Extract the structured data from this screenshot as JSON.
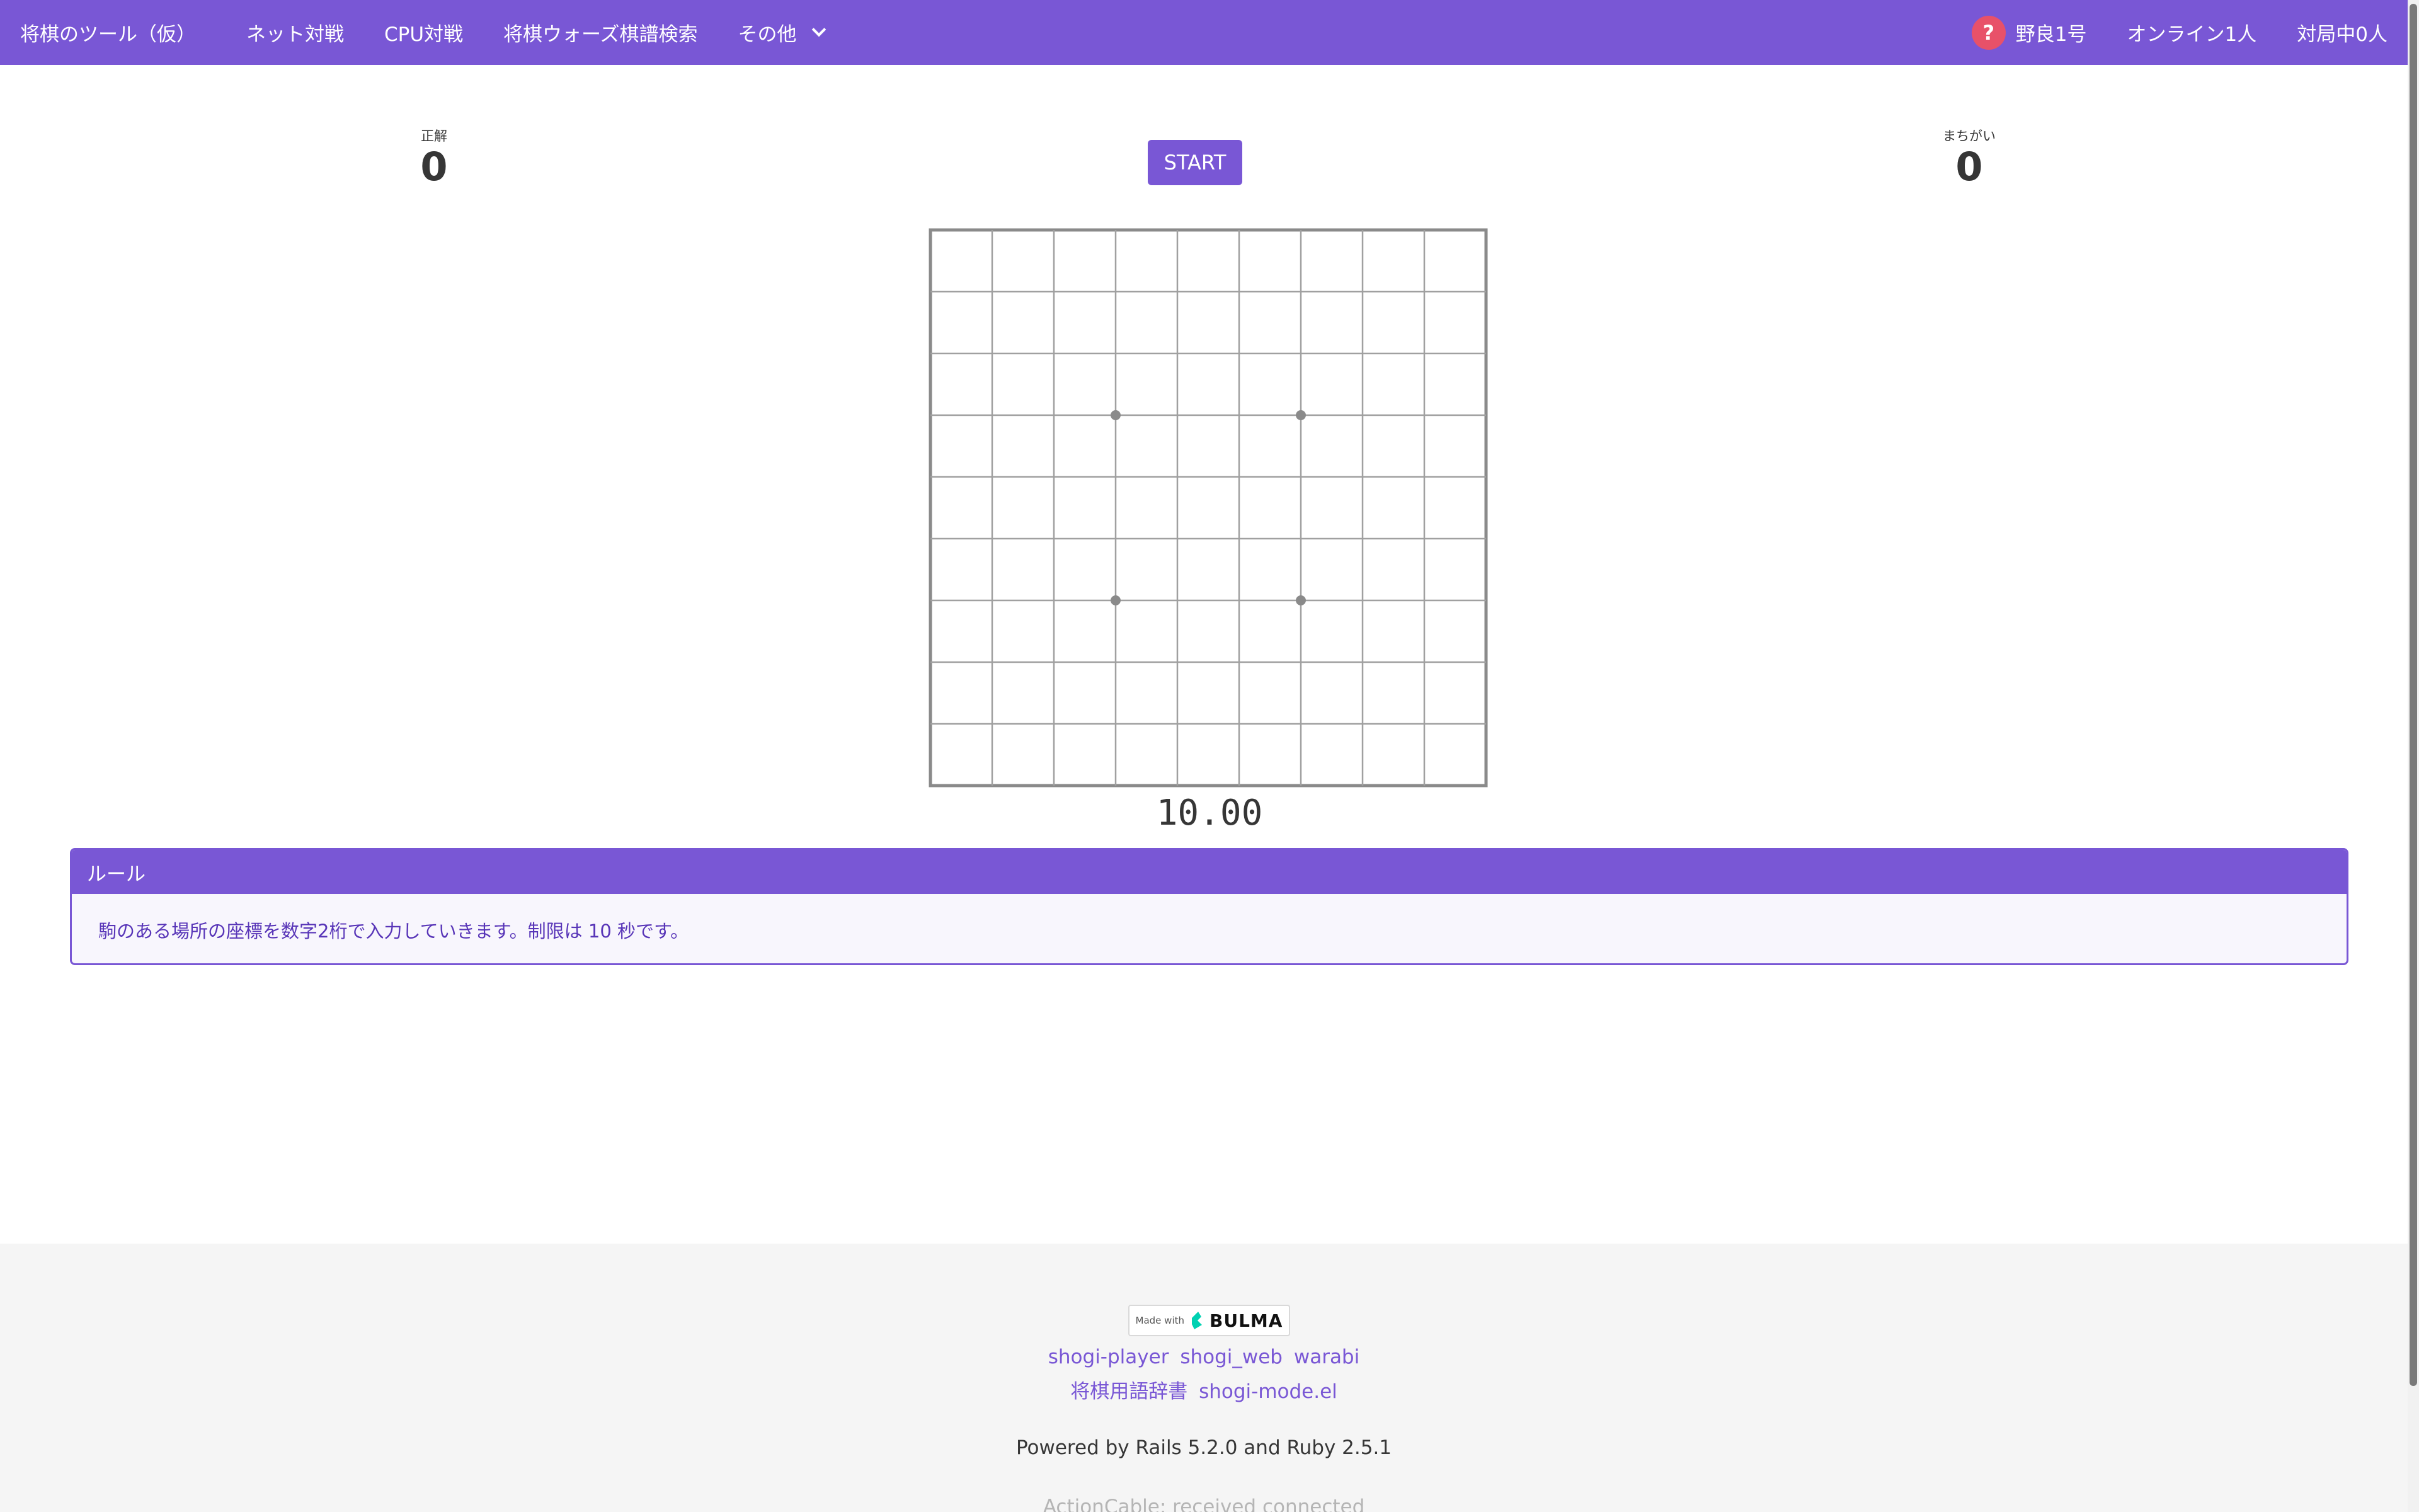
{
  "navbar": {
    "brand": "将棋のツール（仮）",
    "items": [
      {
        "label": "ネット対戦"
      },
      {
        "label": "CPU対戦"
      },
      {
        "label": "将棋ウォーズ棋譜検索"
      },
      {
        "label": "その他"
      }
    ],
    "user": {
      "icon": "question-icon",
      "icon_glyph": "?",
      "name": "野良1号"
    },
    "online": "オンライン1人",
    "playing": "対局中0人",
    "color": "#7957d5"
  },
  "score": {
    "correct_label": "正解",
    "correct_value": "0",
    "wrong_label": "まちがい",
    "wrong_value": "0"
  },
  "start_button": "START",
  "board": {
    "files": 9,
    "ranks": 9,
    "star_points": 4
  },
  "timer": "10.00",
  "rule": {
    "title": "ルール",
    "text": "駒のある場所の座標を数字2桁で入力していきます。制限は 10 秒です。"
  },
  "footer": {
    "badge_made": "Made with",
    "badge_name": "BULMA",
    "links_row1": [
      "shogi-player",
      "shogi_web",
      "warabi"
    ],
    "links_row2": [
      "将棋用語辞書",
      "shogi-mode.el"
    ],
    "powered": "Powered by Rails 5.2.0 and Ruby 2.5.1",
    "cable": "ActionCable: received connected"
  }
}
